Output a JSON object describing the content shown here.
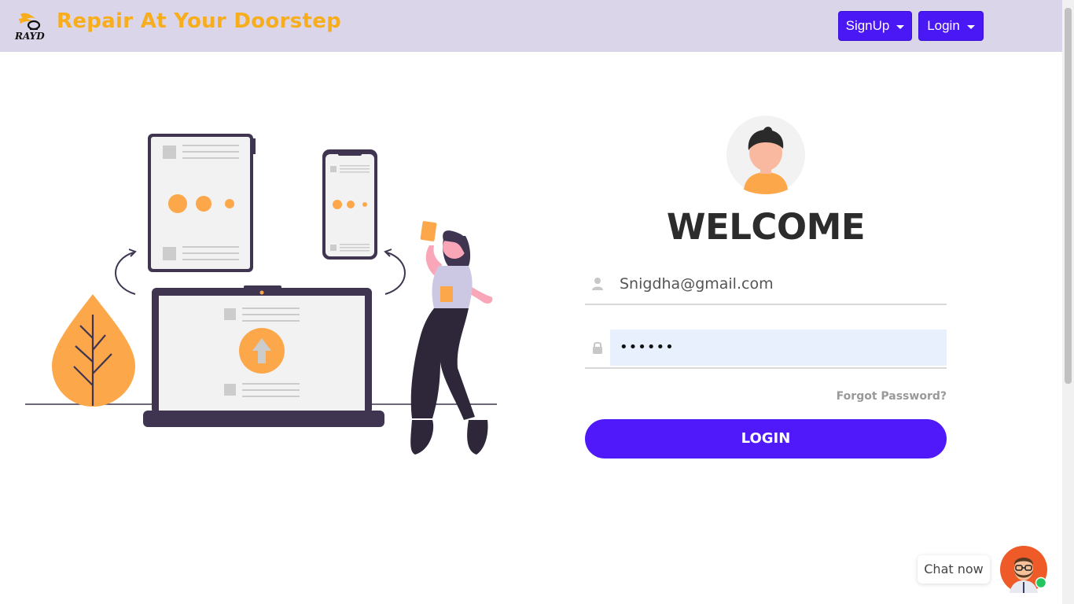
{
  "header": {
    "logo_text": "RAYD",
    "brand": "Repair At Your Doorstep",
    "signup_label": "SignUp",
    "login_label": "Login"
  },
  "login_form": {
    "title": "WELCOME",
    "email_value": "Snigdha@gmail.com",
    "password_masked": "••••••",
    "forgot_label": "Forgot Password?",
    "submit_label": "LOGIN"
  },
  "chat": {
    "label": "Chat now"
  },
  "colors": {
    "navbar_bg": "#dad5e9",
    "brand": "#f8ad1d",
    "primary": "#4f19fa",
    "accent_orange": "#fca84a",
    "dark_purple": "#3f3551"
  },
  "icons": [
    "user-icon",
    "lock-icon",
    "caret-down-icon",
    "arrow-up-icon"
  ]
}
